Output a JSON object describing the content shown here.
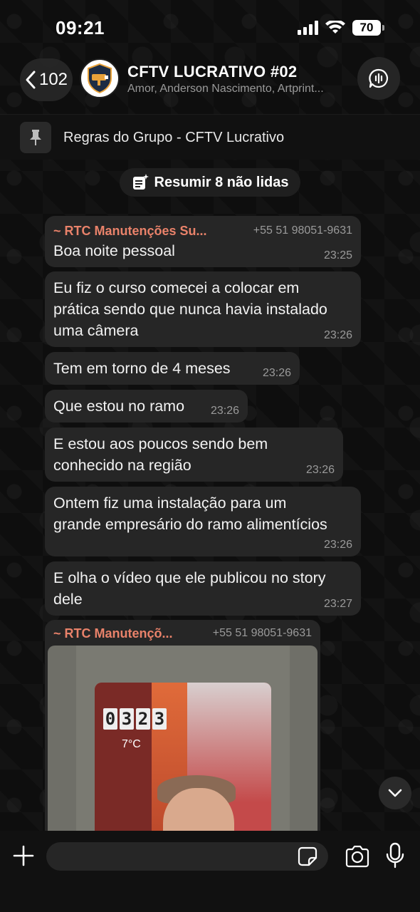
{
  "status_bar": {
    "time": "09:21",
    "battery": "70"
  },
  "header": {
    "back_count": "102",
    "title": "CFTV LUCRATIVO #02",
    "members": "Amor, Anderson Nascimento, Artprint..."
  },
  "pinned": {
    "text": "Regras do Grupo - CFTV Lucrativo"
  },
  "summary": {
    "label": "Resumir 8 não lidas"
  },
  "messages": [
    {
      "sender": "~ RTC Manutenções Su...",
      "phone": "+55 51 98051-9631",
      "lines": [
        "Boa noite pessoal"
      ],
      "time": "23:25"
    },
    {
      "lines": [
        "Eu fiz o curso comecei a colocar em",
        "prática sendo que nunca havia instalado",
        "uma câmera"
      ],
      "time": "23:26"
    },
    {
      "lines": [
        "Tem em torno de 4 meses"
      ],
      "time": "23:26"
    },
    {
      "lines": [
        "Que estou no ramo"
      ],
      "time": "23:26"
    },
    {
      "lines": [
        "E estou aos poucos sendo bem",
        "conhecido na região"
      ],
      "time": "23:26"
    },
    {
      "lines": [
        "Ontem fiz uma instalação para um",
        "grande empresário do ramo alimentícios"
      ],
      "time": "23:26"
    },
    {
      "lines": [
        "E olha o vídeo que ele publicou no story",
        "dele"
      ],
      "time": "23:27"
    }
  ],
  "video_message": {
    "sender": "~ RTC Manutençõ...",
    "phone": "+55 51 98051-9631",
    "clock_digits": [
      "0",
      "3",
      "2",
      "3"
    ],
    "temperature": "7°C"
  },
  "icons": {
    "back": "chevron-left-icon",
    "call": "voice-chat-icon",
    "pin": "pin-icon",
    "summary": "document-sparkle-icon",
    "scroll": "chevron-down-icon",
    "plus": "plus-icon",
    "sticker": "sticker-icon",
    "camera": "camera-icon",
    "mic": "microphone-icon"
  },
  "colors": {
    "sender_name": "#e9826a",
    "bubble": "#262626",
    "background": "#0e0e0e"
  }
}
